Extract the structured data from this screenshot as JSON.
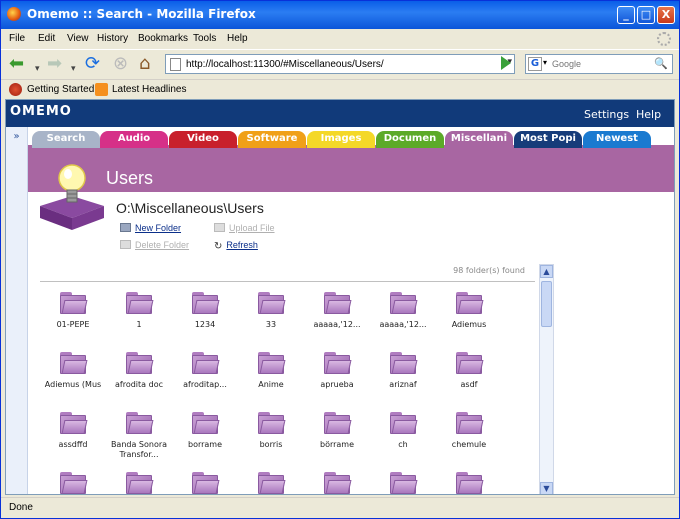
{
  "window": {
    "title": "Omemo :: Search - Mozilla Firefox",
    "controls": [
      "_",
      "□",
      "X"
    ]
  },
  "menubar": [
    "File",
    "Edit",
    "View",
    "History",
    "Bookmarks",
    "Tools",
    "Help"
  ],
  "navbar": {
    "url": "http://localhost:11300/#Miscellaneous/Users/",
    "search_placeholder": "Google"
  },
  "bookmarks": [
    "Getting Started",
    "Latest Headlines"
  ],
  "app": {
    "logo": "OMEMO",
    "links": [
      "Settings",
      "Help"
    ],
    "collapse": "»",
    "tabs": [
      {
        "label": "Search",
        "color": "#a8b4c8"
      },
      {
        "label": "Audio",
        "color": "#d63088"
      },
      {
        "label": "Video",
        "color": "#c8202c"
      },
      {
        "label": "Software",
        "color": "#f0a018"
      },
      {
        "label": "Images",
        "color": "#f4d828"
      },
      {
        "label": "Documen",
        "color": "#5caa28"
      },
      {
        "label": "Miscellani",
        "color": "#a866a2"
      },
      {
        "label": "Most Popi",
        "color": "#163c7a"
      },
      {
        "label": "Newest",
        "color": "#1a7ad0"
      }
    ],
    "section_title": "Users",
    "path": "O:\\Miscellaneous\\Users",
    "actions": {
      "new_folder": "New Folder",
      "upload_file": "Upload File",
      "delete_folder": "Delete Folder",
      "refresh": "Refresh"
    },
    "found": "98 folder(s) found",
    "folders": [
      "01-PEPE",
      "1",
      "1234",
      "33",
      "aaaaa,'12...",
      "aaaaa,'12...",
      "Adiemus",
      "Adiemus (Mus",
      "afrodita doc",
      "afroditap...",
      "Anime",
      "aprueba",
      "ariznaf",
      "asdf",
      "assdffd",
      "Banda Sonora Transfor...",
      "borrame",
      "borris",
      "börrame",
      "ch",
      "chemule",
      "",
      "",
      "",
      "",
      "",
      "",
      ""
    ]
  },
  "status": "Done",
  "colors": {
    "titlebar": "#0a5ee8",
    "app_header": "#113a7a",
    "banner": "#a866a2",
    "folder": "#b07cc0"
  }
}
